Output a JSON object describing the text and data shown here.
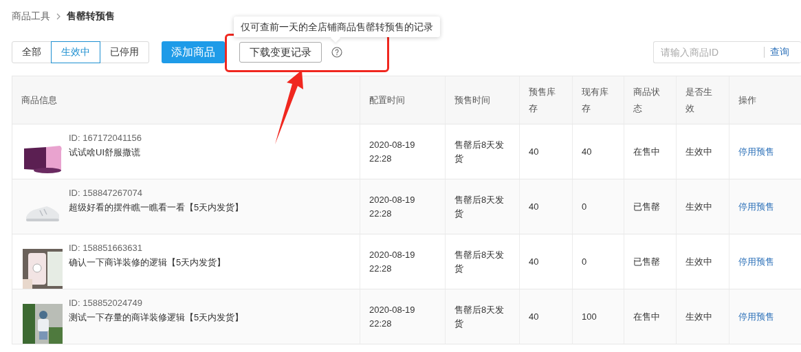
{
  "breadcrumb": [
    {
      "label": "商品工具",
      "current": false
    },
    {
      "label": "售罄转预售",
      "current": true
    }
  ],
  "tabs": [
    {
      "label": "全部",
      "selected": false
    },
    {
      "label": "生效中",
      "selected": true
    },
    {
      "label": "已停用",
      "selected": false
    }
  ],
  "add_button": "添加商品",
  "download_button": "下载变更记录",
  "help_tooltip": "仅可查前一天的全店铺商品售罄转预售的记录",
  "search": {
    "placeholder": "请输入商品ID",
    "button": "查询"
  },
  "table": {
    "columns": [
      "商品信息",
      "配置时间",
      "预售时间",
      "预售库存",
      "现有库存",
      "商品状态",
      "是否生效",
      "操作"
    ],
    "rows": [
      {
        "id": "ID: 167172041156",
        "name": "试试啥UI舒服撒谎",
        "config_time": "2020-08-19 22:28",
        "presale_time": "售罄后8天发货",
        "presale_stock": "40",
        "stock": "40",
        "status": "在售中",
        "effective": "生效中",
        "action": "停用预售"
      },
      {
        "id": "ID: 158847267074",
        "name": "超级好看的摆件瞧一瞧看一看【5天内发货】",
        "config_time": "2020-08-19 22:28",
        "presale_time": "售罄后8天发货",
        "presale_stock": "40",
        "stock": "0",
        "status": "已售罄",
        "effective": "生效中",
        "action": "停用预售"
      },
      {
        "id": "ID: 158851663631",
        "name": "确认一下商详装修的逻辑【5天内发货】",
        "config_time": "2020-08-19 22:28",
        "presale_time": "售罄后8天发货",
        "presale_stock": "40",
        "stock": "0",
        "status": "已售罄",
        "effective": "生效中",
        "action": "停用预售"
      },
      {
        "id": "ID: 158852024749",
        "name": "测试一下存量的商详装修逻辑【5天内发货】",
        "config_time": "2020-08-19 22:28",
        "presale_time": "售罄后8天发货",
        "presale_stock": "40",
        "stock": "100",
        "status": "在售中",
        "effective": "生效中",
        "action": "停用预售"
      }
    ]
  }
}
